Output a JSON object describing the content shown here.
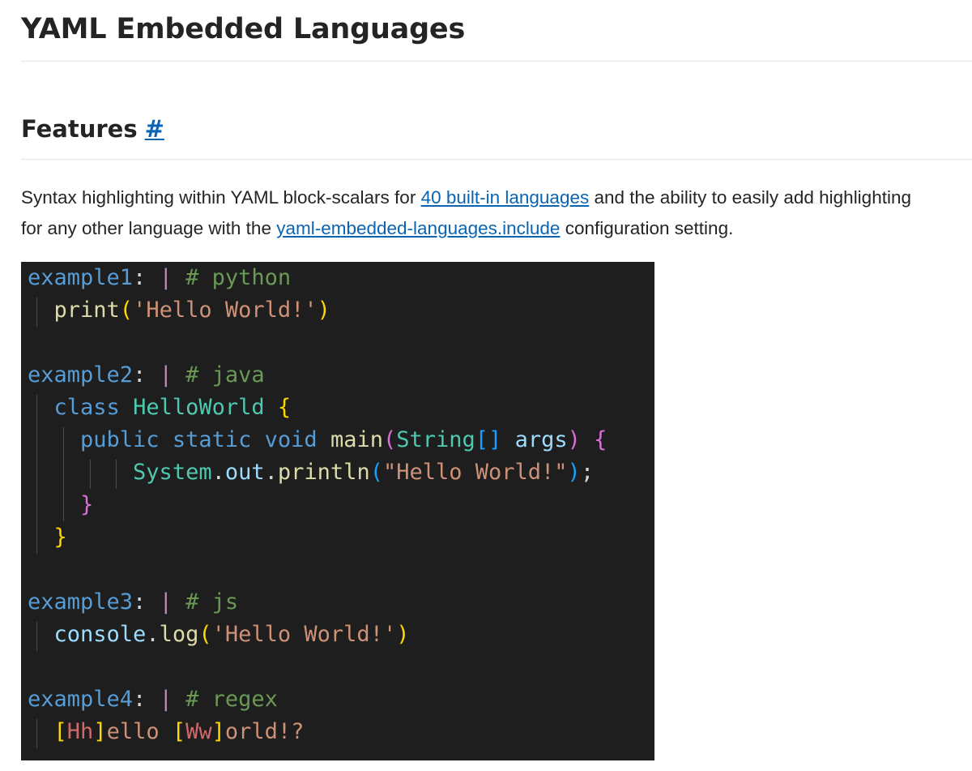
{
  "page": {
    "title": "YAML Embedded Languages"
  },
  "features": {
    "heading": "Features",
    "anchor": "#",
    "description_part1": "Syntax highlighting within YAML block-scalars for ",
    "link1_text": "40 built-in languages",
    "description_part2": " and the ability to easily add highlighting",
    "description_part3": "for any other language with the ",
    "link2_text": "yaml-embedded-languages.include",
    "description_part4": " configuration setting."
  },
  "code": {
    "example1_key": "example1",
    "example1_comment": "# python",
    "example1_fn": "print",
    "example1_str": "'Hello World!'",
    "example2_key": "example2",
    "example2_comment": "# java",
    "example2_class_kw": "class",
    "example2_class_name": "HelloWorld",
    "example2_public": "public",
    "example2_static": "static",
    "example2_void": "void",
    "example2_main": "main",
    "example2_string_type": "String",
    "example2_args": "args",
    "example2_system": "System",
    "example2_out": "out",
    "example2_println": "println",
    "example2_str": "\"Hello World!\"",
    "example3_key": "example3",
    "example3_comment": "# js",
    "example3_console": "console",
    "example3_log": "log",
    "example3_str": "'Hello World!'",
    "example4_key": "example4",
    "example4_comment": "# regex",
    "example4_class1": "Hh",
    "example4_text1": "ello ",
    "example4_class2": "Ww",
    "example4_text2": "orld!?"
  },
  "colors": {
    "code_background": "#1e1e1e",
    "link": "#0a64b4",
    "yaml_key": "#569cd6",
    "comment": "#6a9955",
    "string": "#ce9178",
    "function": "#dcdcaa",
    "type": "#4ec9b0",
    "bracket_gold": "#ffd700",
    "bracket_orchid": "#da70d6"
  }
}
